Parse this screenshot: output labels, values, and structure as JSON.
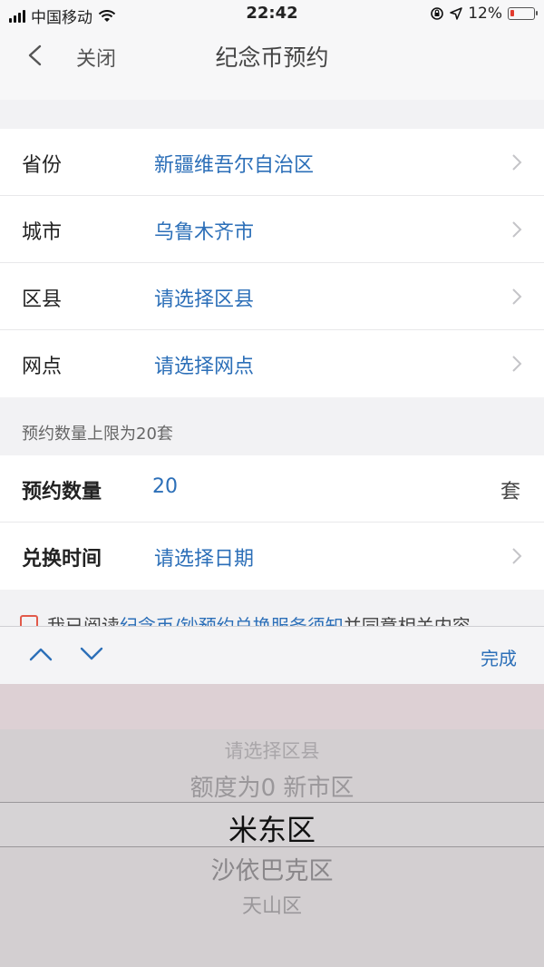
{
  "status_bar": {
    "carrier": "中国移动",
    "time": "22:42",
    "battery": "12%"
  },
  "nav": {
    "close_label": "关闭",
    "title": "纪念币预约"
  },
  "location_rows": [
    {
      "label": "省份",
      "value": "新疆维吾尔自治区"
    },
    {
      "label": "城市",
      "value": "乌鲁木齐市"
    },
    {
      "label": "区县",
      "value": "请选择区县"
    },
    {
      "label": "网点",
      "value": "请选择网点"
    }
  ],
  "hint": "预约数量上限为20套",
  "quantity": {
    "label": "预约数量",
    "value": "20",
    "unit": "套"
  },
  "exchange_time": {
    "label": "兑换时间",
    "value": "请选择日期"
  },
  "agreement": {
    "prefix": "我已阅读",
    "link": "纪念币/钞预约兑换服务须知",
    "suffix": "并同意相关内容"
  },
  "toolbar": {
    "done_label": "完成"
  },
  "picker": {
    "options": [
      "请选择区县",
      "额度为0 新市区",
      "米东区",
      "沙依巴克区",
      "天山区"
    ],
    "selected": "米东区"
  },
  "colors": {
    "accent": "#2c6fb8",
    "battery_low": "#e23b2e"
  }
}
